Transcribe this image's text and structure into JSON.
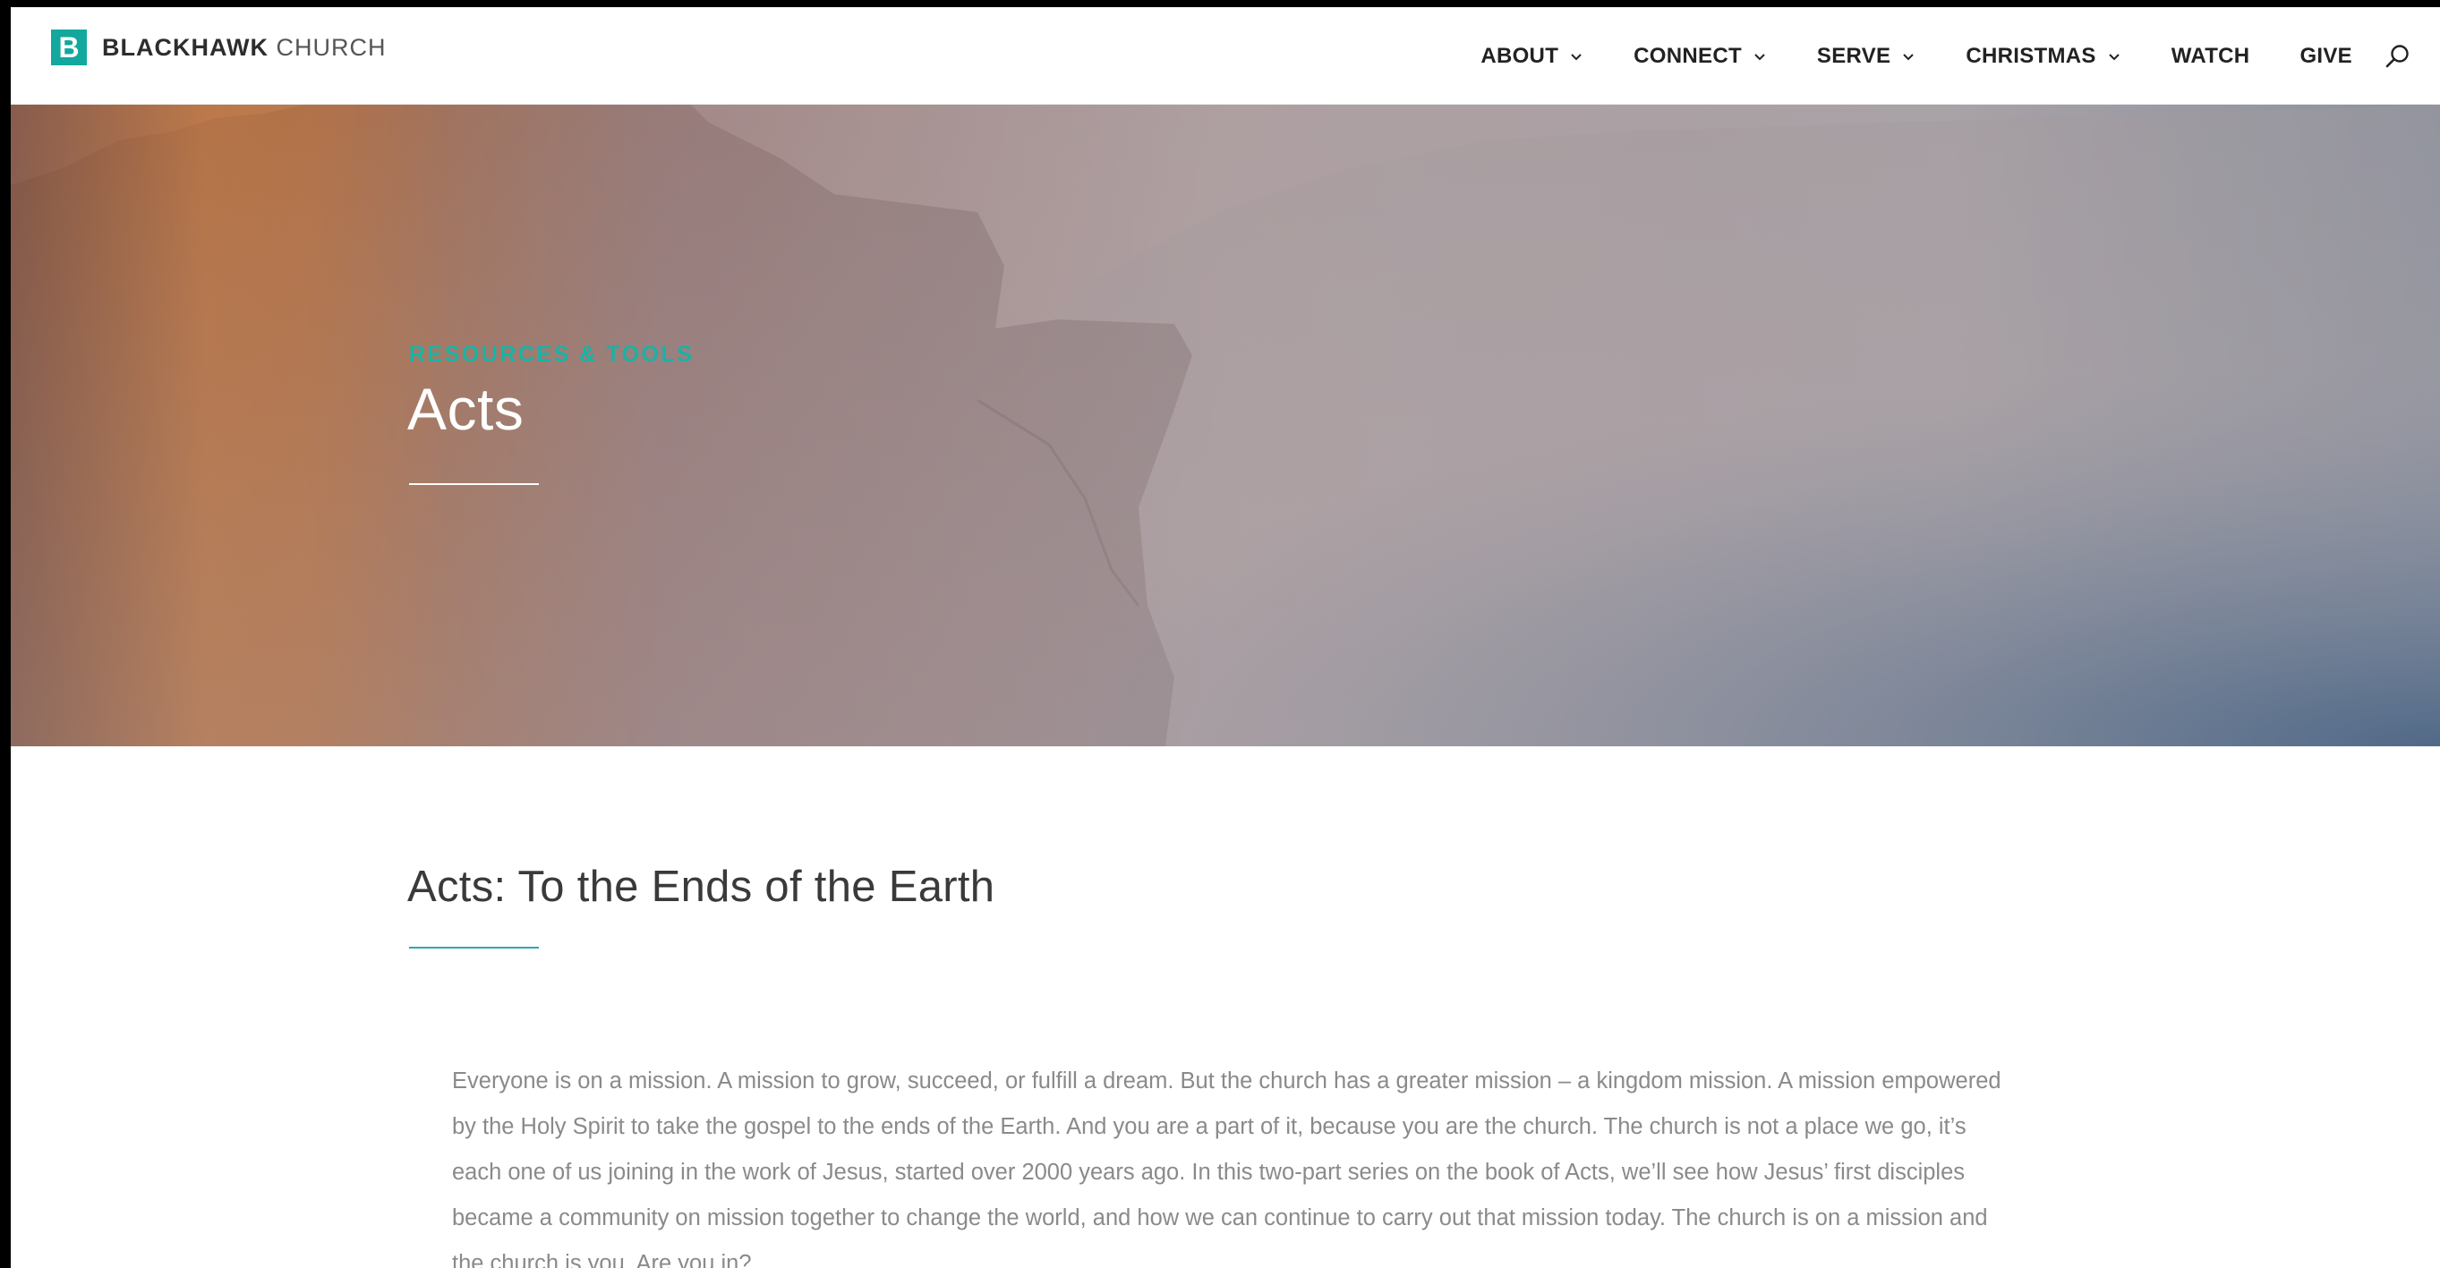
{
  "brand": {
    "mark": "B",
    "name_bold": "BLACKHAWK",
    "name_light": "CHURCH",
    "accent": "#12a89d"
  },
  "nav": {
    "items": [
      {
        "label": "ABOUT",
        "has_dropdown": true
      },
      {
        "label": "CONNECT",
        "has_dropdown": true
      },
      {
        "label": "SERVE",
        "has_dropdown": true
      },
      {
        "label": "CHRISTMAS",
        "has_dropdown": true
      },
      {
        "label": "WATCH",
        "has_dropdown": false
      },
      {
        "label": "GIVE",
        "has_dropdown": false
      }
    ],
    "search_icon": "search-icon"
  },
  "hero": {
    "eyebrow": "RESOURCES & TOOLS",
    "title": "Acts",
    "eyebrow_color": "#17b3a6"
  },
  "content": {
    "title": "Acts: To the Ends of the Earth",
    "rule_color": "#2aa6b7",
    "paragraph": "Everyone is on a mission. A mission to grow, succeed, or fulfill a dream. But the church has a greater mission – a kingdom mission. A mission empowered by the Holy Spirit to take the gospel to the ends of the Earth. And you are a part of it, because you are the church. The church is not a place we go, it’s each one of us joining in the work of Jesus, started over 2000 years ago. In this two-part series on the book of Acts, we’ll see how Jesus’ first disciples became a community on mission together to change the world, and how we can continue to carry out that mission today. The church is on a mission and the church is you. Are you in?"
  }
}
